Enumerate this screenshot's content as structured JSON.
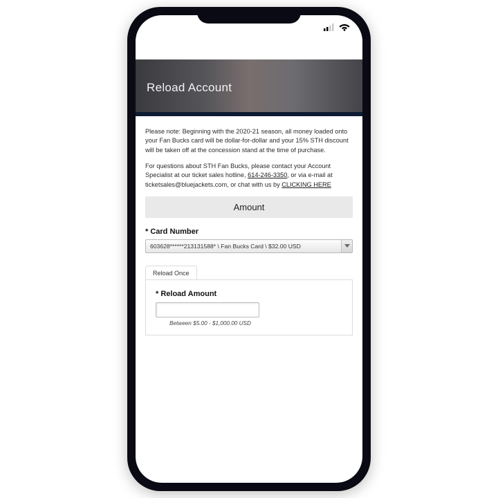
{
  "hero": {
    "title": "Reload Account"
  },
  "notes": {
    "p1": "Please note: Beginning with the 2020-21 season, all money loaded onto your Fan Bucks card will be dollar-for-dollar and your 15% STH discount will be taken off at the concession stand at the time of purchase.",
    "p2_prefix": "For questions about STH Fan Bucks, please contact your Account Specialist at our ticket sales hotline, ",
    "phone": "614-246-3350",
    "p2_mid": ", or via e-mail at ticketsales@bluejackets.com, or chat with us by ",
    "click_here": "CLICKING HERE"
  },
  "amount_header": "Amount",
  "card": {
    "label": "* Card Number",
    "selected": "603628******213131588* \\ Fan Bucks Card \\ $32.00 USD"
  },
  "tabs": {
    "reload_once": "Reload Once"
  },
  "reload": {
    "label": "* Reload Amount",
    "value": "",
    "hint": "Between $5.00 - $1,000.00 USD"
  }
}
